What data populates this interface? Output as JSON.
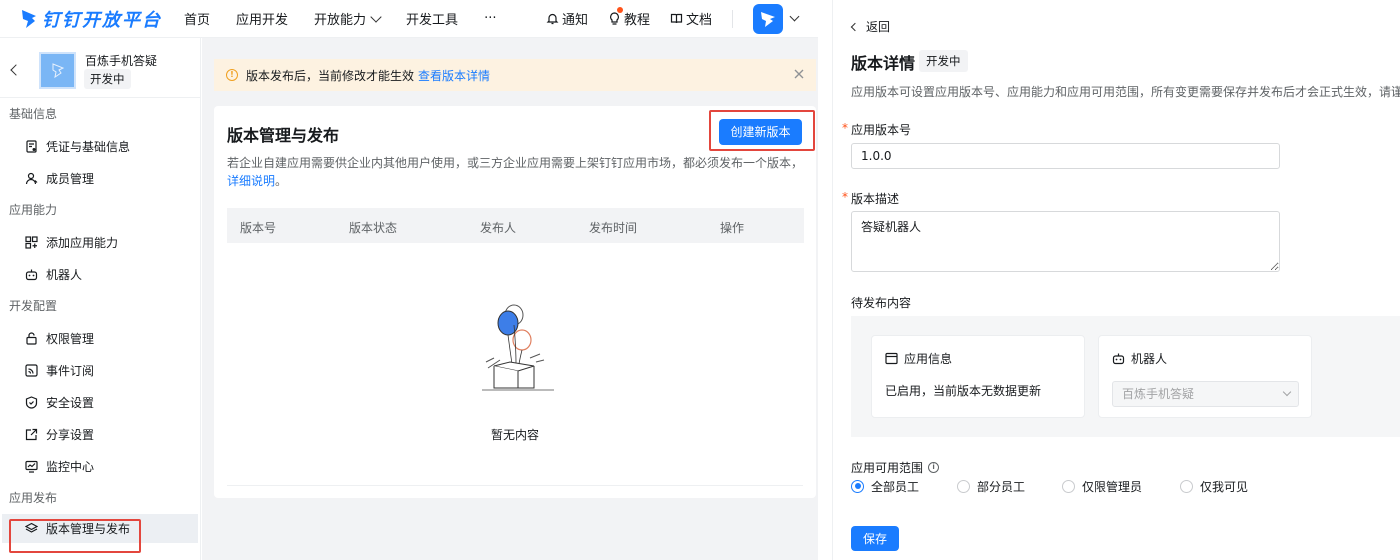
{
  "header": {
    "brand": "钉钉开放平台",
    "nav": [
      {
        "label": "首页"
      },
      {
        "label": "应用开发"
      },
      {
        "label": "开放能力",
        "has_dropdown": true
      },
      {
        "label": "开发工具"
      },
      {
        "label": "···"
      }
    ],
    "notify_label": "通知",
    "tutorial_label": "教程",
    "docs_label": "文档"
  },
  "sidebar": {
    "app_name": "百炼手机答疑",
    "app_status": "开发中",
    "groups": [
      {
        "title": "基础信息",
        "items": [
          {
            "label": "凭证与基础信息",
            "icon": "credential-icon"
          },
          {
            "label": "成员管理",
            "icon": "member-icon"
          }
        ]
      },
      {
        "title": "应用能力",
        "items": [
          {
            "label": "添加应用能力",
            "icon": "grid-plus-icon"
          },
          {
            "label": "机器人",
            "icon": "robot-icon"
          }
        ]
      },
      {
        "title": "开发配置",
        "items": [
          {
            "label": "权限管理",
            "icon": "lock-icon"
          },
          {
            "label": "事件订阅",
            "icon": "rss-icon"
          },
          {
            "label": "安全设置",
            "icon": "shield-icon"
          },
          {
            "label": "分享设置",
            "icon": "share-icon"
          },
          {
            "label": "监控中心",
            "icon": "monitor-icon"
          }
        ]
      },
      {
        "title": "应用发布",
        "items": [
          {
            "label": "版本管理与发布",
            "icon": "layers-icon",
            "active": true
          }
        ]
      }
    ]
  },
  "notice": {
    "text": "版本发布后，当前修改才能生效",
    "link": "查看版本详情"
  },
  "main": {
    "title": "版本管理与发布",
    "create_button": "创建新版本",
    "description": "若企业自建应用需要供企业内其他用户使用，或三方企业应用需要上架钉钉应用市场，都必须发布一个版本，",
    "description_link": "详细说明",
    "description_end": "。",
    "table_columns": [
      "版本号",
      "版本状态",
      "发布人",
      "发布时间",
      "操作"
    ],
    "empty_text": "暂无内容"
  },
  "detail": {
    "back_label": "返回",
    "title": "版本详情",
    "status": "开发中",
    "description": "应用版本可设置应用版本号、应用能力和应用可用范围，所有变更需要保存并发布后才会正式生效，请谨慎操作",
    "version_label": "应用版本号",
    "version_value": "1.0.0",
    "desc_label": "版本描述",
    "desc_value": "答疑机器人",
    "pending_label": "待发布内容",
    "app_info_title": "应用信息",
    "app_info_text": "已启用，当前版本无数据更新",
    "robot_title": "机器人",
    "robot_select_value": "百炼手机答疑",
    "scope_label": "应用可用范围",
    "scope_options": [
      {
        "label": "全部员工",
        "checked": true
      },
      {
        "label": "部分员工",
        "checked": false
      },
      {
        "label": "仅限管理员",
        "checked": false
      },
      {
        "label": "仅我可见",
        "checked": false
      }
    ],
    "save_button": "保存"
  },
  "colors": {
    "primary": "#1a7cff",
    "highlight_frame": "#e3463d",
    "notice_bg": "#fdf2e1"
  }
}
